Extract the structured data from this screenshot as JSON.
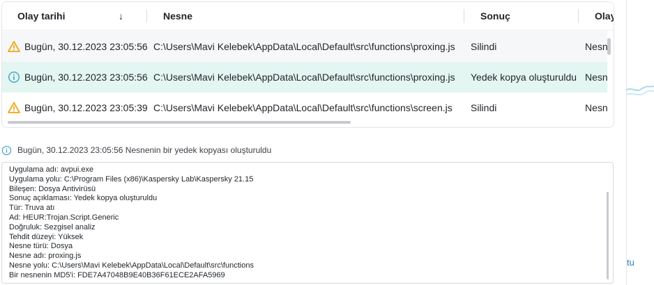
{
  "table": {
    "columns": {
      "date": "Olay tarihi",
      "object": "Nesne",
      "result": "Sonuç",
      "type": "Olay"
    },
    "rows": [
      {
        "icon": "warning-icon",
        "date": "Bugün, 30.12.2023 23:05:56",
        "object": "C:\\Users\\Mavi Kelebek\\AppData\\Local\\Default\\src\\functions\\proxing.js",
        "result": "Silindi",
        "type": "Nesne"
      },
      {
        "icon": "info-icon",
        "date": "Bugün, 30.12.2023 23:05:56",
        "object": "C:\\Users\\Mavi Kelebek\\AppData\\Local\\Default\\src\\functions\\proxing.js",
        "result": "Yedek kopya oluşturuldu",
        "type": "Nesne"
      },
      {
        "icon": "warning-icon",
        "date": "Bugün, 30.12.2023 23:05:39",
        "object": "C:\\Users\\Mavi Kelebek\\AppData\\Local\\Default\\src\\functions\\screen.js",
        "result": "Silindi",
        "type": "Nesne"
      }
    ]
  },
  "detail": {
    "header": "Bugün, 30.12.2023 23:05:56 Nesnenin bir yedek kopyası oluşturuldu",
    "lines": [
      "Uygulama adı: avpui.exe",
      "Uygulama yolu: C:\\Program Files (x86)\\Kaspersky Lab\\Kaspersky 21.15",
      "Bileşen: Dosya Antivirüsü",
      "Sonuç açıklaması: Yedek kopya oluşturuldu",
      "Tür: Truva atı",
      "Ad: HEUR:Trojan.Script.Generic",
      "Doğruluk: Sezgisel analiz",
      "Tehdit düzeyi: Yüksek",
      "Nesne türü: Dosya",
      "Nesne adı: proxing.js",
      "Nesne yolu: C:\\Users\\Mavi Kelebek\\AppData\\Local\\Default\\src\\functions",
      "Bir nesnenin MD5'i: FDE7A47048B9E40B36F61ECE2AFA5969"
    ]
  },
  "background": {
    "link_fragment": "tu"
  },
  "colors": {
    "warning": "#f2a516",
    "info": "#3fa0c9",
    "selected_row": "#e3f6f2"
  }
}
